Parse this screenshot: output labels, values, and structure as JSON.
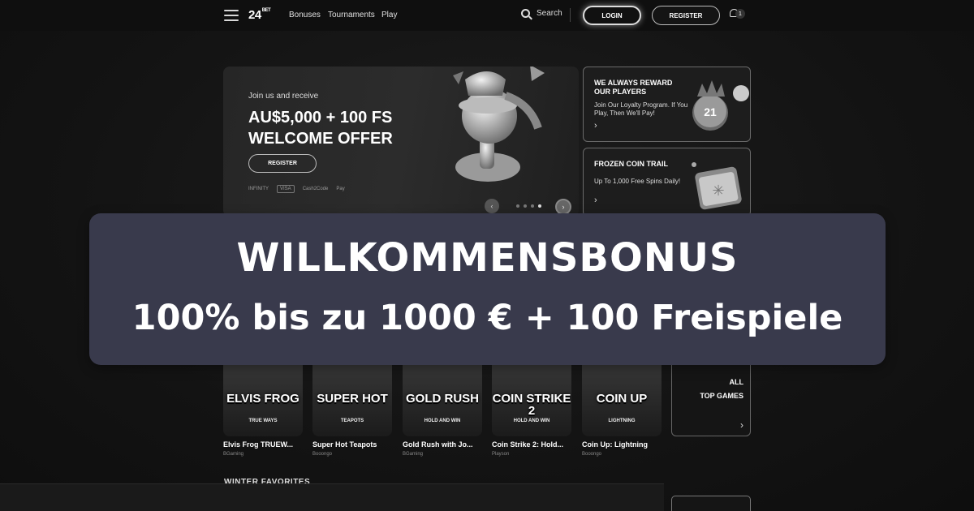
{
  "nav": {
    "logo": "24",
    "logo_suffix": "BET",
    "links": [
      "Bonuses",
      "Tournaments",
      "Play"
    ],
    "search_label": "Search",
    "login_label": "LOGIN",
    "register_label": "REGISTER",
    "notification_count": "1"
  },
  "hero": {
    "kicker": "Join us and receive",
    "title": "AU$5,000 + 100 FS WELCOME OFFER",
    "register_label": "REGISTER",
    "payments": [
      "INFINITY",
      "VISA",
      "Cash2Code",
      "Pay"
    ],
    "slides": 4,
    "active_slide": 4
  },
  "promos": [
    {
      "title": "WE ALWAYS REWARD OUR PLAYERS",
      "text": "Join Our Loyalty Program. If You Play, Then We'll Pay!",
      "arrow": "›",
      "badge": "21"
    },
    {
      "title": "FROZEN COIN TRAIL",
      "text": "Up To 1,000 Free Spins Daily!",
      "arrow": "›"
    }
  ],
  "games": [
    {
      "logo": "ELVIS FROG",
      "sub": "TRUE WAYS",
      "name": "Elvis Frog TRUEW...",
      "provider": "BGaming"
    },
    {
      "logo": "SUPER HOT",
      "sub": "TEAPOTS",
      "name": "Super Hot Teapots",
      "provider": "Booongo"
    },
    {
      "logo": "GOLD RUSH",
      "sub": "HOLD AND WIN",
      "name": "Gold Rush with Jo...",
      "provider": "BGaming"
    },
    {
      "logo": "COIN STRIKE 2",
      "sub": "HOLD AND WIN",
      "name": "Coin Strike 2: Hold...",
      "provider": "Playson"
    },
    {
      "logo": "COIN UP",
      "sub": "LIGHTNING",
      "name": "Coin Up: Lightning",
      "provider": "Booongo"
    }
  ],
  "all_top_games": {
    "line1": "ALL",
    "line2": "TOP GAMES",
    "arrow": "›"
  },
  "section_title": "WINTER FAVORITES",
  "banner": {
    "title": "WILLKOMMENSBONUS",
    "subtitle": "100% bis zu 1000 € + 100 Freispiele"
  },
  "colors": {
    "banner_bg": "#393a4c",
    "page_bg": "#121212"
  }
}
